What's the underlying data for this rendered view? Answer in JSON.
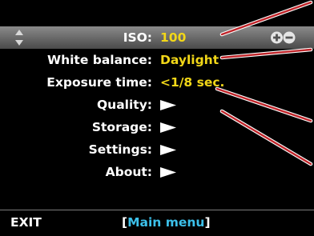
{
  "menu": {
    "rows": [
      {
        "label": "ISO:",
        "value": "100"
      },
      {
        "label": "White balance:",
        "value": "Daylight"
      },
      {
        "label": "Exposure time:",
        "value": "<1/8 sec."
      },
      {
        "label": "Quality:"
      },
      {
        "label": "Storage:"
      },
      {
        "label": "Settings:"
      },
      {
        "label": "About:"
      }
    ],
    "selected_index": 0
  },
  "footer": {
    "exit_label": "EXIT",
    "bracket_open": "[",
    "title": "Main menu",
    "bracket_close": "]"
  },
  "icons": {
    "selector": "up-down-arrows-icon",
    "adjust": "plus-minus-icon",
    "submenu": "right-triangle-icon"
  },
  "colors": {
    "background": "#000000",
    "label": "#ffffff",
    "value": "#f2d718",
    "title": "#3cc0ea",
    "pointer": "#c0252a"
  }
}
